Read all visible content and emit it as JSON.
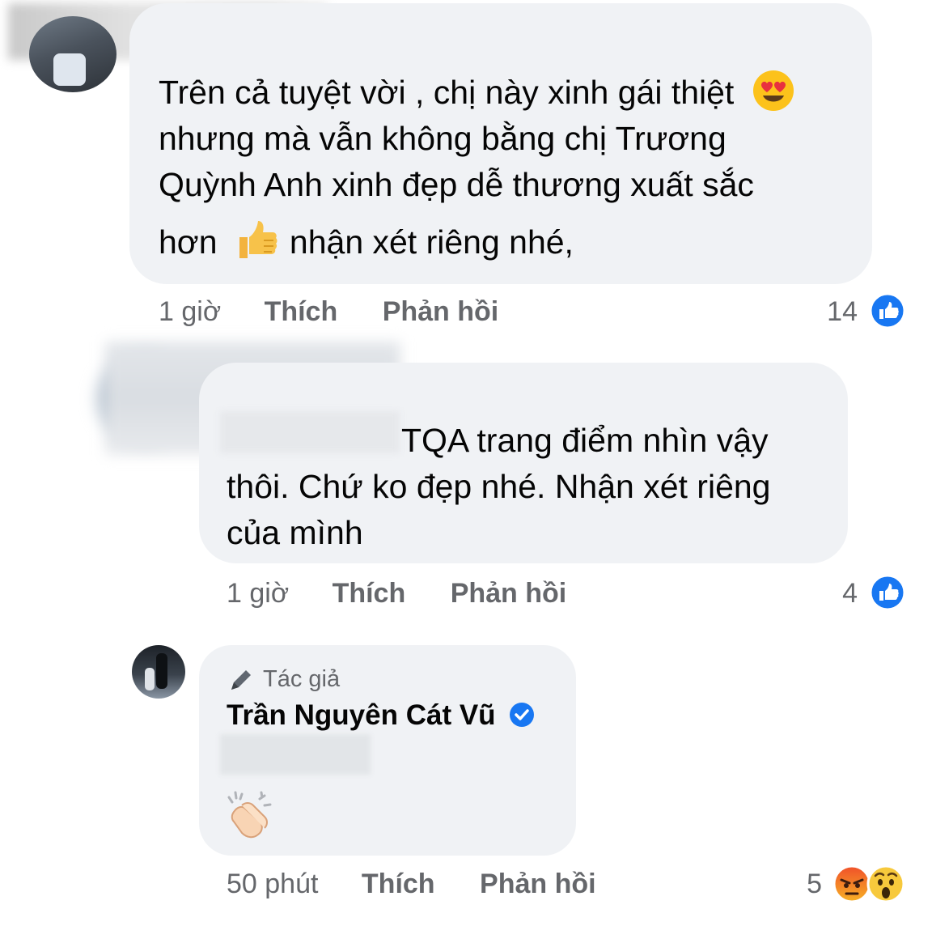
{
  "comments": [
    {
      "text_parts": [
        "Trên cả tuyệt vời , chị này xinh gái thiệt",
        "nhưng mà vẫn không bằng chị Trương",
        "Quỳnh Anh xinh đẹp dễ thương xuất sắc",
        "hơn",
        "nhận xét riêng nhé,"
      ],
      "time": "1 giờ",
      "like_label": "Thích",
      "reply_label": "Phản hồi",
      "reaction_count": "14"
    },
    {
      "text_parts": [
        "TQA trang điểm nhìn vậy",
        "thôi. Chứ ko đẹp nhé. Nhận xét riêng",
        "của mình"
      ],
      "time": "1 giờ",
      "like_label": "Thích",
      "reply_label": "Phản hồi",
      "reaction_count": "4"
    },
    {
      "author_badge": "Tác giả",
      "author_name": "Trần Nguyên Cát Vũ",
      "time": "50 phút",
      "like_label": "Thích",
      "reply_label": "Phản hồi",
      "reaction_count": "5"
    }
  ],
  "colors": {
    "bubble": "#f0f2f5",
    "like_blue": "#1877f2",
    "meta_gray": "#65676b",
    "verified": "#1877f2"
  },
  "icons": [
    "heart-eyes-emoji",
    "thumbs-up-emoji",
    "like-reaction-icon",
    "pencil-icon",
    "verified-badge-icon",
    "clapping-hands-emoji",
    "angry-reaction-icon",
    "wow-reaction-icon"
  ]
}
